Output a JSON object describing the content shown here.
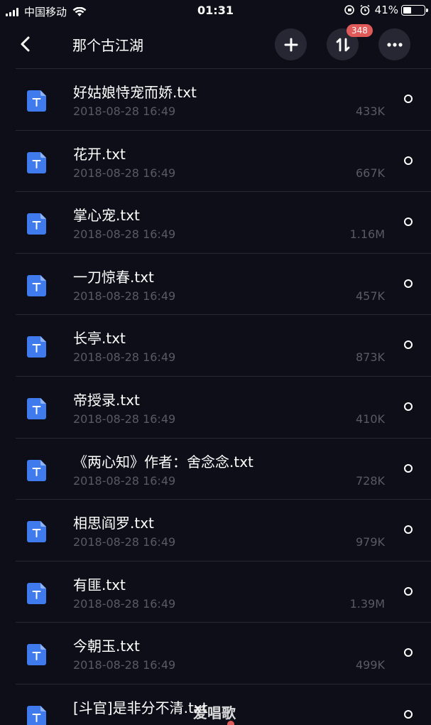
{
  "status_bar": {
    "carrier": "中国移动",
    "time": "01:31",
    "battery_percent": "41%",
    "battery_level": 0.41
  },
  "nav": {
    "title": "那个古江湖",
    "badge_count": "348",
    "icons": {
      "back": "chevron-left-icon",
      "add": "plus-icon",
      "transfer": "up-down-arrows-icon",
      "more": "ellipsis-icon"
    }
  },
  "files": [
    {
      "name": "好姑娘恃宠而娇.txt",
      "date": "2018-08-28 16:49",
      "size": "433K"
    },
    {
      "name": "花开.txt",
      "date": "2018-08-28 16:49",
      "size": "667K"
    },
    {
      "name": "掌心宠.txt",
      "date": "2018-08-28 16:49",
      "size": "1.16M"
    },
    {
      "name": "一刀惊春.txt",
      "date": "2018-08-28 16:49",
      "size": "457K"
    },
    {
      "name": "长亭.txt",
      "date": "2018-08-28 16:49",
      "size": "873K"
    },
    {
      "name": "帝授录.txt",
      "date": "2018-08-28 16:49",
      "size": "410K"
    },
    {
      "name": "《两心知》作者：舍念念.txt",
      "date": "2018-08-28 16:49",
      "size": "728K"
    },
    {
      "name": "相思阎罗.txt",
      "date": "2018-08-28 16:49",
      "size": "979K"
    },
    {
      "name": "有匪.txt",
      "date": "2018-08-28 16:49",
      "size": "1.39M"
    },
    {
      "name": "今朝玉.txt",
      "date": "2018-08-28 16:49",
      "size": "499K"
    },
    {
      "name": "[斗官]是非分不清.txt",
      "date": "",
      "size": ""
    }
  ],
  "watermark": "爱唱歌",
  "colors": {
    "background": "#0d0e17",
    "file_icon": "#3f7bec",
    "badge": "#e05a5a",
    "secondary_text": "#585a66"
  }
}
